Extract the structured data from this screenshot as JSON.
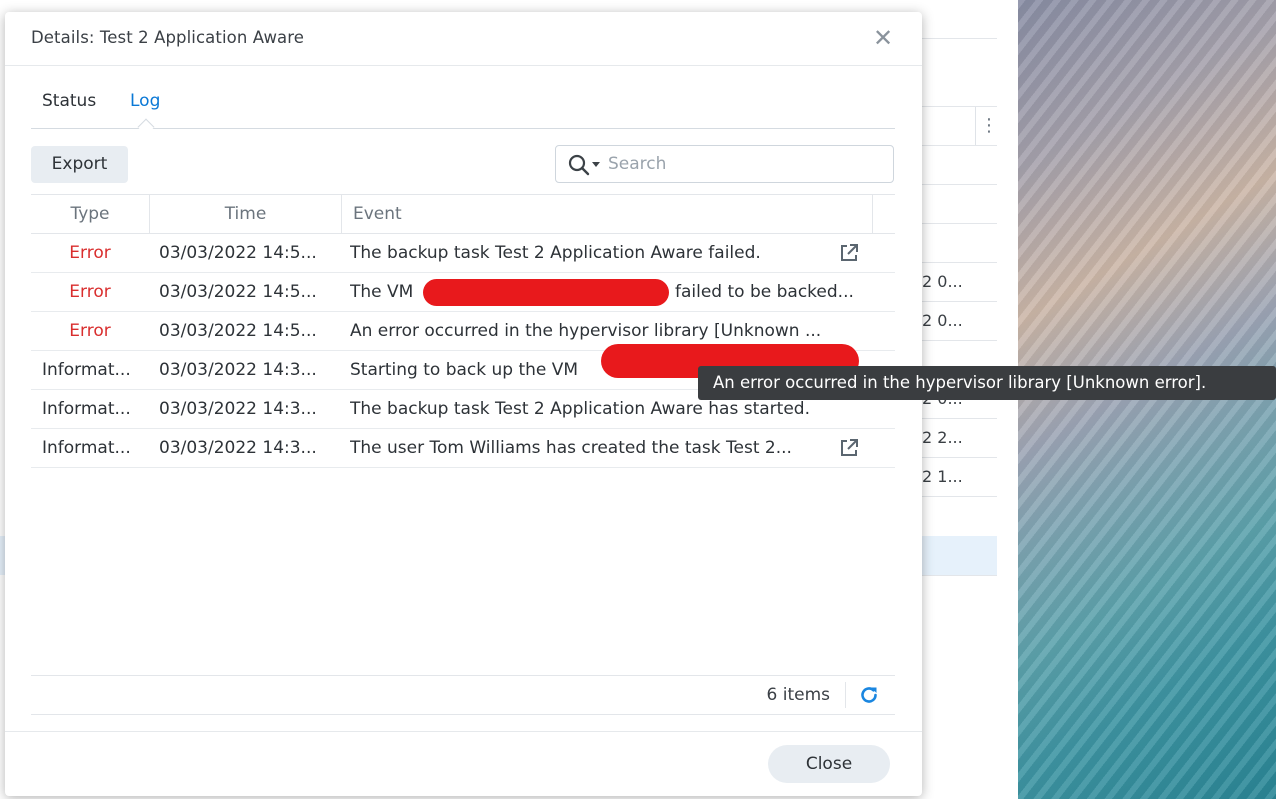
{
  "dialog": {
    "title": "Details: Test 2 Application Aware",
    "close_icon": "close-icon"
  },
  "tabs": [
    {
      "label": "Status",
      "active": false
    },
    {
      "label": "Log",
      "active": true
    }
  ],
  "toolbar": {
    "export_label": "Export",
    "search_placeholder": "Search"
  },
  "table": {
    "columns": [
      "Type",
      "Time",
      "Event"
    ],
    "rows": [
      {
        "type": "Error",
        "time": "03/03/2022 14:5...",
        "event": "The backup task Test 2 Application Aware failed.",
        "has_link": true
      },
      {
        "type": "Error",
        "time": "03/03/2022 14:5...",
        "event": "The VM",
        "event_suffix": "failed to be backed...",
        "has_link": false
      },
      {
        "type": "Error",
        "time": "03/03/2022 14:5...",
        "event": "An error occurred in the hypervisor library [Unknown ...",
        "has_link": false
      },
      {
        "type": "Informat...",
        "time": "03/03/2022 14:3...",
        "event": "Starting to back up the VM",
        "has_link": false
      },
      {
        "type": "Informat...",
        "time": "03/03/2022 14:3...",
        "event": "The backup task Test 2 Application Aware has started.",
        "has_link": false
      },
      {
        "type": "Informat...",
        "time": "03/03/2022 14:3...",
        "event": "The user Tom Williams has created the task Test 2...",
        "has_link": true
      }
    ]
  },
  "footer": {
    "item_count": "6 items"
  },
  "close_button": "Close",
  "tooltip": "An error occurred in the hypervisor library [Unknown error].",
  "background": {
    "cells": [
      "2 0...",
      "2 0...",
      "2 0...",
      "2 2...",
      "2 1..."
    ]
  },
  "colors": {
    "error": "#d92e2e",
    "accent": "#0a78d6",
    "redaction": "#e8191c"
  }
}
